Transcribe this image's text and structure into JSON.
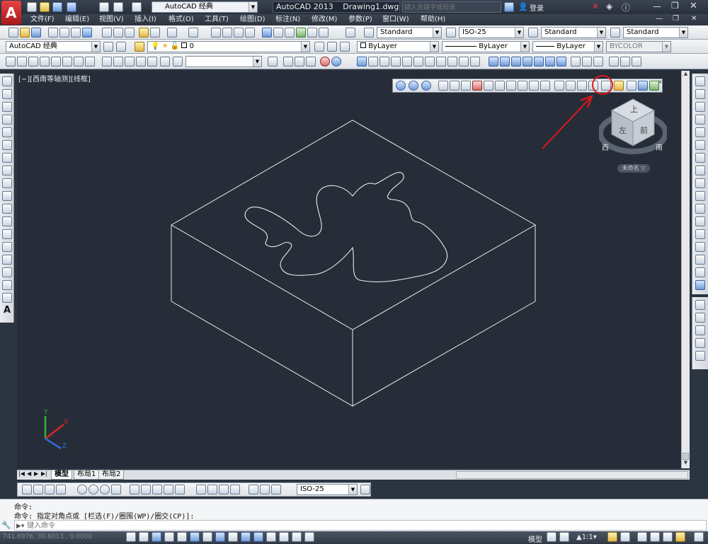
{
  "app": {
    "name": "AutoCAD 2013",
    "document": "Drawing1.dwg",
    "workspace": "AutoCAD 经典",
    "search_placeholder": "键入关键字或短语",
    "login": "登录"
  },
  "menu": [
    "文件(F)",
    "编辑(E)",
    "视图(V)",
    "插入(I)",
    "格式(O)",
    "工具(T)",
    "绘图(D)",
    "标注(N)",
    "修改(M)",
    "参数(P)",
    "窗口(W)",
    "帮助(H)"
  ],
  "toolbar": {
    "text_style": "Standard",
    "dim_style": "ISO-25",
    "table_style": "Standard",
    "multileader_style": "Standard",
    "workspace_combo": "AutoCAD 经典",
    "layer": "0",
    "color": "ByLayer",
    "linetype": "ByLayer",
    "lineweight": "ByLayer",
    "plotstyle": "BYCOLOR"
  },
  "viewport": {
    "label": "[−][西南等轴测][线框]",
    "viewcube": {
      "top_face": "上",
      "front_face": "前",
      "left_face": "左",
      "compass_west": "西",
      "compass_south": "南",
      "ucs_label": "未命名 ▽"
    },
    "ucs": {
      "x": "X",
      "y": "Y",
      "z": "Z"
    }
  },
  "tabs": [
    "模型",
    "布局1",
    "布局2"
  ],
  "dim_toolbar_combo": "ISO-25",
  "command": {
    "line1": "命令:",
    "line2": "命令: 指定对角点或 [栏选(F)/圈围(WP)/圈交(CP)]:",
    "prompt": "键入命令"
  },
  "status": {
    "coords": "741.6976, 30.6013 , 0.0000",
    "model": "模型",
    "scale": "1:1"
  },
  "colors": {
    "canvas": "#262d38",
    "linework": "#e8ecf0",
    "annotation": "#e8141a"
  }
}
